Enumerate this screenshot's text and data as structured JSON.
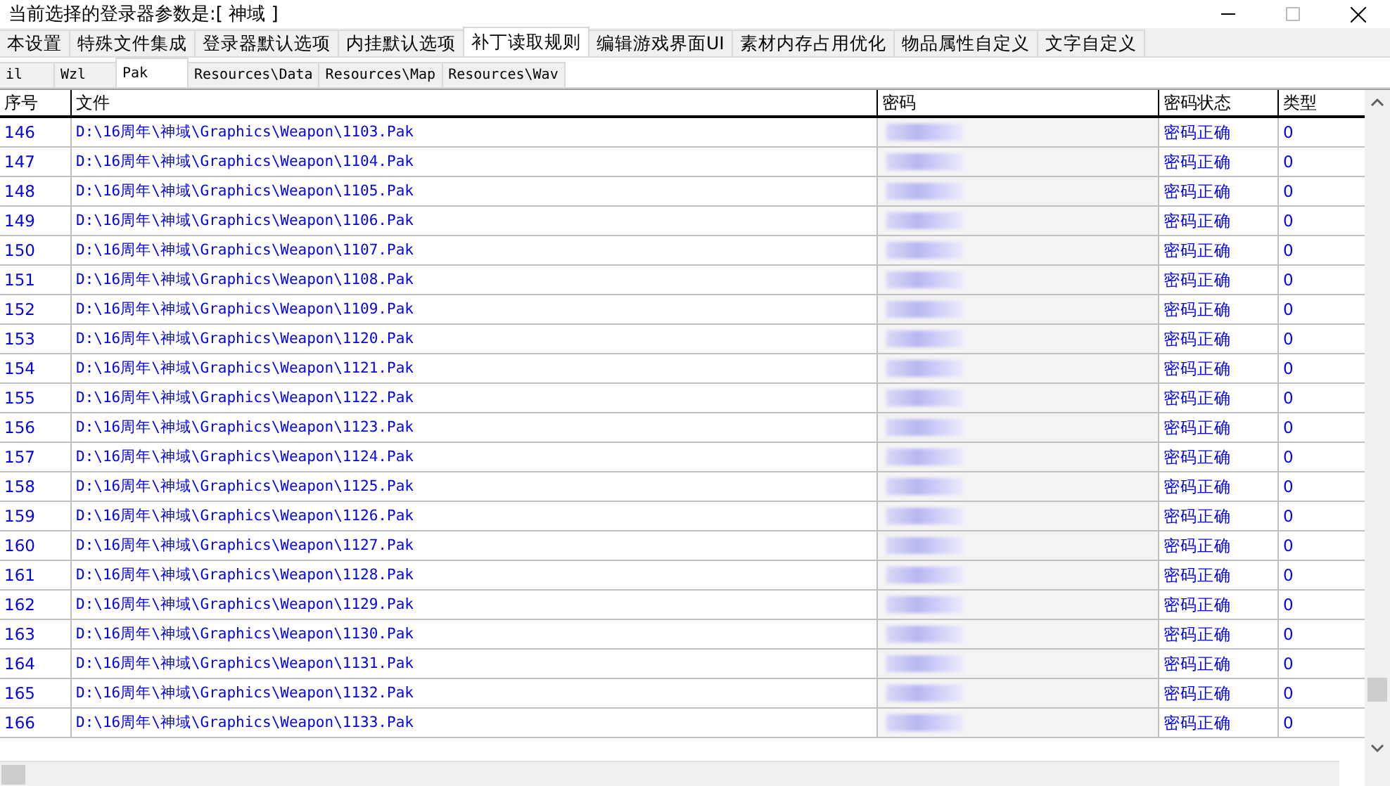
{
  "window": {
    "title": "当前选择的登录器参数是:[ 神域 ]"
  },
  "tabs": [
    {
      "label": "本设置",
      "selected": false
    },
    {
      "label": "特殊文件集成",
      "selected": false
    },
    {
      "label": "登录器默认选项",
      "selected": false
    },
    {
      "label": "内挂默认选项",
      "selected": false
    },
    {
      "label": "补丁读取规则",
      "selected": true
    },
    {
      "label": "编辑游戏界面UI",
      "selected": false
    },
    {
      "label": "素材内存占用优化",
      "selected": false
    },
    {
      "label": "物品属性自定义",
      "selected": false
    },
    {
      "label": "文字自定义",
      "selected": false
    }
  ],
  "subtabs": [
    {
      "label": "il",
      "selected": false
    },
    {
      "label": "Wzl",
      "selected": false
    },
    {
      "label": "Pak",
      "selected": true
    },
    {
      "label": "Resources\\Data",
      "selected": false
    },
    {
      "label": "Resources\\Map",
      "selected": false
    },
    {
      "label": "Resources\\Wav",
      "selected": false
    }
  ],
  "table": {
    "columns": [
      "序号",
      "文件",
      "密码",
      "密码状态",
      "类型"
    ],
    "rows": [
      {
        "index": "146",
        "file": "D:\\16周年\\神域\\Graphics\\Weapon\\1103.Pak",
        "status": "密码正确",
        "type": "0"
      },
      {
        "index": "147",
        "file": "D:\\16周年\\神域\\Graphics\\Weapon\\1104.Pak",
        "status": "密码正确",
        "type": "0"
      },
      {
        "index": "148",
        "file": "D:\\16周年\\神域\\Graphics\\Weapon\\1105.Pak",
        "status": "密码正确",
        "type": "0"
      },
      {
        "index": "149",
        "file": "D:\\16周年\\神域\\Graphics\\Weapon\\1106.Pak",
        "status": "密码正确",
        "type": "0"
      },
      {
        "index": "150",
        "file": "D:\\16周年\\神域\\Graphics\\Weapon\\1107.Pak",
        "status": "密码正确",
        "type": "0"
      },
      {
        "index": "151",
        "file": "D:\\16周年\\神域\\Graphics\\Weapon\\1108.Pak",
        "status": "密码正确",
        "type": "0"
      },
      {
        "index": "152",
        "file": "D:\\16周年\\神域\\Graphics\\Weapon\\1109.Pak",
        "status": "密码正确",
        "type": "0"
      },
      {
        "index": "153",
        "file": "D:\\16周年\\神域\\Graphics\\Weapon\\1120.Pak",
        "status": "密码正确",
        "type": "0"
      },
      {
        "index": "154",
        "file": "D:\\16周年\\神域\\Graphics\\Weapon\\1121.Pak",
        "status": "密码正确",
        "type": "0"
      },
      {
        "index": "155",
        "file": "D:\\16周年\\神域\\Graphics\\Weapon\\1122.Pak",
        "status": "密码正确",
        "type": "0"
      },
      {
        "index": "156",
        "file": "D:\\16周年\\神域\\Graphics\\Weapon\\1123.Pak",
        "status": "密码正确",
        "type": "0"
      },
      {
        "index": "157",
        "file": "D:\\16周年\\神域\\Graphics\\Weapon\\1124.Pak",
        "status": "密码正确",
        "type": "0"
      },
      {
        "index": "158",
        "file": "D:\\16周年\\神域\\Graphics\\Weapon\\1125.Pak",
        "status": "密码正确",
        "type": "0"
      },
      {
        "index": "159",
        "file": "D:\\16周年\\神域\\Graphics\\Weapon\\1126.Pak",
        "status": "密码正确",
        "type": "0"
      },
      {
        "index": "160",
        "file": "D:\\16周年\\神域\\Graphics\\Weapon\\1127.Pak",
        "status": "密码正确",
        "type": "0"
      },
      {
        "index": "161",
        "file": "D:\\16周年\\神域\\Graphics\\Weapon\\1128.Pak",
        "status": "密码正确",
        "type": "0"
      },
      {
        "index": "162",
        "file": "D:\\16周年\\神域\\Graphics\\Weapon\\1129.Pak",
        "status": "密码正确",
        "type": "0"
      },
      {
        "index": "163",
        "file": "D:\\16周年\\神域\\Graphics\\Weapon\\1130.Pak",
        "status": "密码正确",
        "type": "0"
      },
      {
        "index": "164",
        "file": "D:\\16周年\\神域\\Graphics\\Weapon\\1131.Pak",
        "status": "密码正确",
        "type": "0"
      },
      {
        "index": "165",
        "file": "D:\\16周年\\神域\\Graphics\\Weapon\\1132.Pak",
        "status": "密码正确",
        "type": "0"
      },
      {
        "index": "166",
        "file": "D:\\16周年\\神域\\Graphics\\Weapon\\1133.Pak",
        "status": "密码正确",
        "type": "0"
      }
    ]
  }
}
